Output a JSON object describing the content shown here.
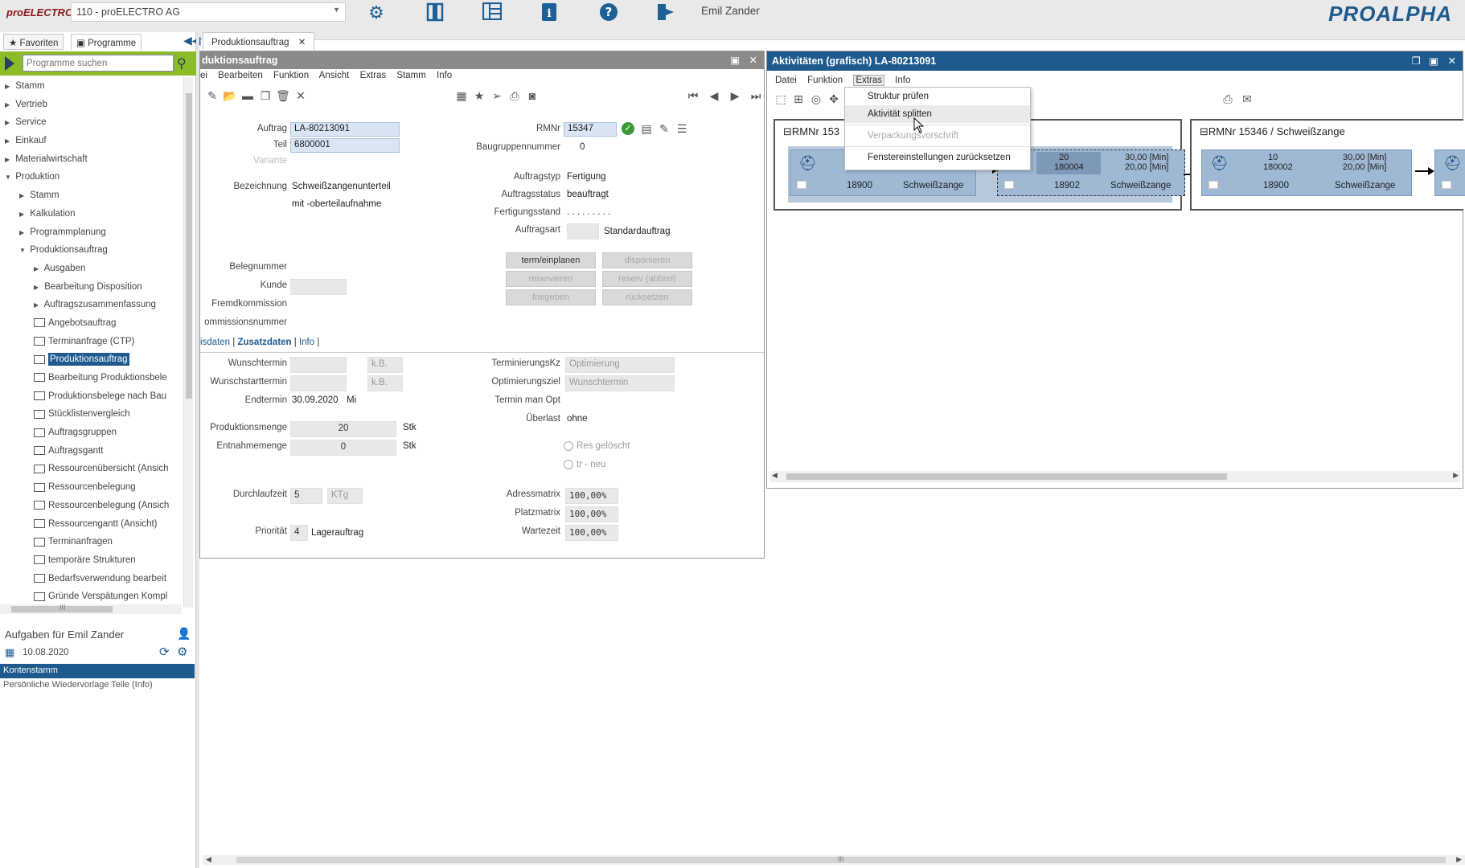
{
  "topbar": {
    "logo": "proELECTRO",
    "company": "110 - proELECTRO AG",
    "user": "Emil Zander",
    "brand": "PROALPHA",
    "icons": [
      "gear-icon",
      "panel-icon",
      "layout-icon",
      "info-icon",
      "help-icon",
      "exit-icon"
    ]
  },
  "left": {
    "tabs": [
      "Favoriten",
      "Programme"
    ],
    "search_placeholder": "Programme suchen",
    "tree": [
      {
        "label": "Stamm",
        "level": 0,
        "type": "folder"
      },
      {
        "label": "Vertrieb",
        "level": 0,
        "type": "folder"
      },
      {
        "label": "Service",
        "level": 0,
        "type": "folder"
      },
      {
        "label": "Einkauf",
        "level": 0,
        "type": "folder"
      },
      {
        "label": "Materialwirtschaft",
        "level": 0,
        "type": "folder"
      },
      {
        "label": "Produktion",
        "level": 0,
        "type": "open"
      },
      {
        "label": "Stamm",
        "level": 1,
        "type": "folder"
      },
      {
        "label": "Kalkulation",
        "level": 1,
        "type": "folder"
      },
      {
        "label": "Programmplanung",
        "level": 1,
        "type": "folder"
      },
      {
        "label": "Produktionsauftrag",
        "level": 1,
        "type": "open"
      },
      {
        "label": "Ausgaben",
        "level": 2,
        "type": "folder"
      },
      {
        "label": "Bearbeitung Disposition",
        "level": 2,
        "type": "folder"
      },
      {
        "label": "Auftragszusammenfassung",
        "level": 2,
        "type": "folder"
      },
      {
        "label": "Angebotsauftrag",
        "level": 2,
        "type": "prog"
      },
      {
        "label": "Terminanfrage (CTP)",
        "level": 2,
        "type": "prog"
      },
      {
        "label": "Produktionsauftrag",
        "level": 2,
        "type": "prog",
        "selected": true
      },
      {
        "label": "Bearbeitung Produktionsbele",
        "level": 2,
        "type": "prog"
      },
      {
        "label": "Produktionsbelege nach Bau",
        "level": 2,
        "type": "prog"
      },
      {
        "label": "Stücklistenvergleich",
        "level": 2,
        "type": "prog"
      },
      {
        "label": "Auftragsgruppen",
        "level": 2,
        "type": "prog"
      },
      {
        "label": "Auftragsgantt",
        "level": 2,
        "type": "prog"
      },
      {
        "label": "Ressourcenübersicht (Ansich",
        "level": 2,
        "type": "prog"
      },
      {
        "label": "Ressourcenbelegung",
        "level": 2,
        "type": "prog"
      },
      {
        "label": "Ressourcenbelegung (Ansich",
        "level": 2,
        "type": "prog"
      },
      {
        "label": "Ressourcengantt (Ansicht)",
        "level": 2,
        "type": "prog"
      },
      {
        "label": "Terminanfragen",
        "level": 2,
        "type": "prog"
      },
      {
        "label": "temporäre Strukturen",
        "level": 2,
        "type": "prog"
      },
      {
        "label": "Bedarfsverwendung bearbeit",
        "level": 2,
        "type": "prog"
      },
      {
        "label": "Gründe Verspätungen Kompl",
        "level": 2,
        "type": "prog"
      }
    ],
    "scroll_label": "III",
    "tasks_title": "Aufgaben für Emil Zander",
    "tasks_date": "10.08.2020",
    "tasks_selected": "Kontenstamm",
    "tasks_item": "Persönliche Wiedervorlage Teile (Info)"
  },
  "doc_tab": {
    "label": "Produktionsauftrag"
  },
  "winL": {
    "title": "duktionsauftrag",
    "menu": [
      "ei",
      "Bearbeiten",
      "Funktion",
      "Ansicht",
      "Extras",
      "Stamm",
      "Info"
    ],
    "auftrag_label": "Auftrag",
    "auftrag": "LA-80213091",
    "teil_label": "Teil",
    "teil": "6800001",
    "variante_label": "Variante",
    "bezeichnung_label": "Bezeichnung",
    "bezeichnung1": "Schweißzangenunterteil",
    "bezeichnung2": "mit -oberteilaufnahme",
    "rmnr_label": "RMNr",
    "rmnr": "15347",
    "baugruppe_label": "Baugruppennummer",
    "baugruppe": "0",
    "auftragstyp_label": "Auftragstyp",
    "auftragstyp": "Fertigung",
    "auftragsstatus_label": "Auftragsstatus",
    "auftragsstatus": "beauftragt",
    "fertigungsstand_label": "Fertigungsstand",
    "fertigungsstand": ". . . . . . . . .",
    "auftragsart_label": "Auftragsart",
    "auftragsart": "Standardauftrag",
    "buttons": [
      "term/einplanen",
      "disponieren",
      "reservieren",
      "reserv (abbrel)",
      "freigeben",
      "rücksetzen"
    ],
    "belegnummer_label": "Belegnummer",
    "kunde_label": "Kunde",
    "fremdkommission_label": "Fremdkommission",
    "kommissionsnummer_label": "ommissionsnummer",
    "subtabs": [
      "isdaten",
      "Zusatzdaten",
      "Info"
    ],
    "wunschtermin_label": "Wunschtermin",
    "wunschstarttermin_label": "Wunschstarttermin",
    "endtermin_label": "Endtermin",
    "endtermin": "30.09.2020",
    "endtermin_day": "Mi",
    "kw1": "k.B.",
    "kw2": "k.B.",
    "terminierungskz_label": "TerminierungsKz",
    "terminierungskz": "Optimierung",
    "optimierungsziel_label": "Optimierungsziel",
    "optimierungsziel": "Wunschtermin",
    "terminmanopt_label": "Termin man Opt",
    "ueberlast_label": "Überlast",
    "ueberlast": "ohne",
    "produktionsmenge_label": "Produktionsmenge",
    "produktionsmenge": "20",
    "pm_unit": "Stk",
    "entnahmemenge_label": "Entnahmemenge",
    "entnahmemenge": "0",
    "em_unit": "Stk",
    "res_geloescht": "Res gelöscht",
    "tr_neu": "tr - neu",
    "durchlaufzeit_label": "Durchlaufzeit",
    "durchlaufzeit": "5",
    "dlz_unit": "KTg",
    "adressmatrix_label": "Adressmatrix",
    "adressmatrix": "100,00%",
    "platzmatrix_label": "Platzmatrix",
    "platzmatrix": "100,00%",
    "prioritaet_label": "Priorität",
    "prioritaet": "4",
    "prioritaet_text": "Lagerauftrag",
    "wartezeit_label": "Wartezeit",
    "wartezeit": "100,00%"
  },
  "winR": {
    "title": "Aktivitäten (grafisch) LA-80213091",
    "menu": [
      "Datei",
      "Funktion",
      "Extras",
      "Info"
    ],
    "group1_title": "RMNr 153",
    "group2_title": "RMNr 15346 / Schweißzange",
    "card1": {
      "id": "18900",
      "name": "Schweißzange"
    },
    "card2": {
      "qty": "20",
      "num": "180004",
      "t1": "30,00 [Min]",
      "t2": "20,00 [Min]",
      "id": "18902",
      "name": "Schweißzange"
    },
    "card3": {
      "qty": "10",
      "num": "180002",
      "t1": "30,00 [Min]",
      "t2": "20,00 [Min]",
      "id": "18900",
      "name": "Schweißzange"
    },
    "dropdown": [
      "Struktur prüfen",
      "Aktivität splitten",
      "Verpackungsvorschrift",
      "Fenstereinstellungen zurücksetzen"
    ]
  },
  "bottom_scroll_label": "III"
}
